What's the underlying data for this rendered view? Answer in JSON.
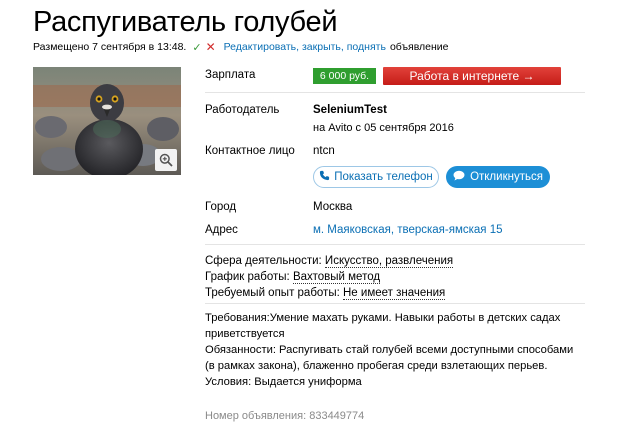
{
  "title": "Распугиватель голубей",
  "meta": {
    "posted": "Размещено 7 сентября в 13:48.",
    "edit_link": "Редактировать, закрыть, поднять",
    "suffix": "объявление"
  },
  "salary": {
    "label": "Зарплата",
    "value": "6 000 руб.",
    "online_button": "Работа в интернете →"
  },
  "employer": {
    "label": "Работодатель",
    "name": "SeleniumTest",
    "since": "на Avito с 05 сентября 2016"
  },
  "contact": {
    "label": "Контактное лицо",
    "name": "ntcn",
    "show_phone": "Показать телефон",
    "respond": "Откликнуться"
  },
  "city": {
    "label": "Город",
    "value": "Москва"
  },
  "address": {
    "label": "Адрес",
    "value": "м. Маяковская, тверская-ямская 15"
  },
  "attributes": [
    {
      "label": "Сфера деятельности:",
      "value": "Искусство, развлечения"
    },
    {
      "label": "График работы:",
      "value": "Вахтовый метод"
    },
    {
      "label": "Требуемый опыт работы:",
      "value": "Не имеет значения"
    }
  ],
  "description": [
    "Требования:Умение махать руками. Навыки работы в детских садах приветствуется",
    "Обязанности: Распугивать стай голубей всеми доступными способами (в рамках закона), блаженно пробегая среди взлетающих перьев.",
    "Условия: Выдается униформа"
  ],
  "ad_number": "Номер объявления: 833449774",
  "colors": {
    "link": "#0a6fb4",
    "salary_bg": "#2f9e2f",
    "online_bg": "#d1241f",
    "respond_bg": "#1d8fd6"
  },
  "icons": [
    "check-icon",
    "cross-icon",
    "zoom-icon",
    "phone-icon",
    "chat-bubble-icon"
  ]
}
